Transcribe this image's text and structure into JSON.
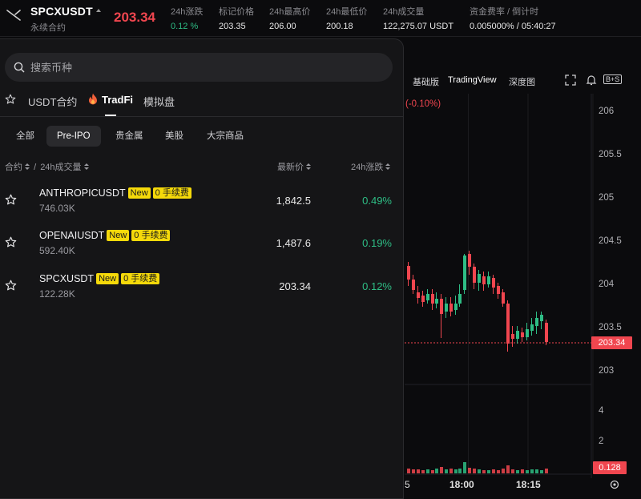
{
  "header": {
    "symbol": "SPCXUSDT",
    "subtitle": "永续合约",
    "last_price": "203.34",
    "stats": [
      {
        "label": "24h涨跌",
        "value": "0.12 %",
        "tone": "green"
      },
      {
        "label": "标记价格",
        "value": "203.35",
        "tone": "normal"
      },
      {
        "label": "24h最高价",
        "value": "206.00",
        "tone": "normal"
      },
      {
        "label": "24h最低价",
        "value": "200.18",
        "tone": "normal"
      },
      {
        "label": "24h成交量",
        "value": "122,275.07 USDT",
        "tone": "normal"
      },
      {
        "label": "资金费率 / 倒计时",
        "value": "0.005000% / 05:40:27",
        "tone": "normal"
      }
    ]
  },
  "panel": {
    "search_placeholder": "搜索币种",
    "tabs": [
      "USDT合约",
      "TradFi",
      "模拟盘"
    ],
    "active_tab": "TradFi",
    "chips": [
      "全部",
      "Pre-IPO",
      "贵金属",
      "美股",
      "大宗商品"
    ],
    "active_chip": "Pre-IPO",
    "columns": {
      "name": "合约",
      "separator": "/",
      "volume": "24h成交量",
      "price": "最新价",
      "change": "24h涨跌"
    },
    "rows": [
      {
        "name": "ANTHROPICUSDT",
        "badges": [
          "New",
          "0 手续费"
        ],
        "volume": "746.03K",
        "price": "1,842.5",
        "change": "0.49%"
      },
      {
        "name": "OPENAIUSDT",
        "badges": [
          "New",
          "0 手续费"
        ],
        "volume": "592.40K",
        "price": "1,487.6",
        "change": "0.19%"
      },
      {
        "name": "SPCXUSDT",
        "badges": [
          "New",
          "0 手续费"
        ],
        "volume": "122.28K",
        "price": "203.34",
        "change": "0.12%"
      }
    ]
  },
  "chart": {
    "toolbar": {
      "basic": "基础版",
      "tradingview": "TradingView",
      "depth": "深度图",
      "badge": "B+S"
    },
    "change_label": "(-0.10%)",
    "y_ticks": [
      "206",
      "205.5",
      "205",
      "204.5",
      "204",
      "203.5",
      "203"
    ],
    "current_price_tag": "203.34",
    "vol_ticks": [
      "4",
      "2"
    ],
    "vol_tag": "0.128",
    "x_ticks": [
      "5",
      "18:00",
      "18:15"
    ],
    "colors": {
      "up": "#2ebd85",
      "down": "#f0464f"
    }
  }
}
